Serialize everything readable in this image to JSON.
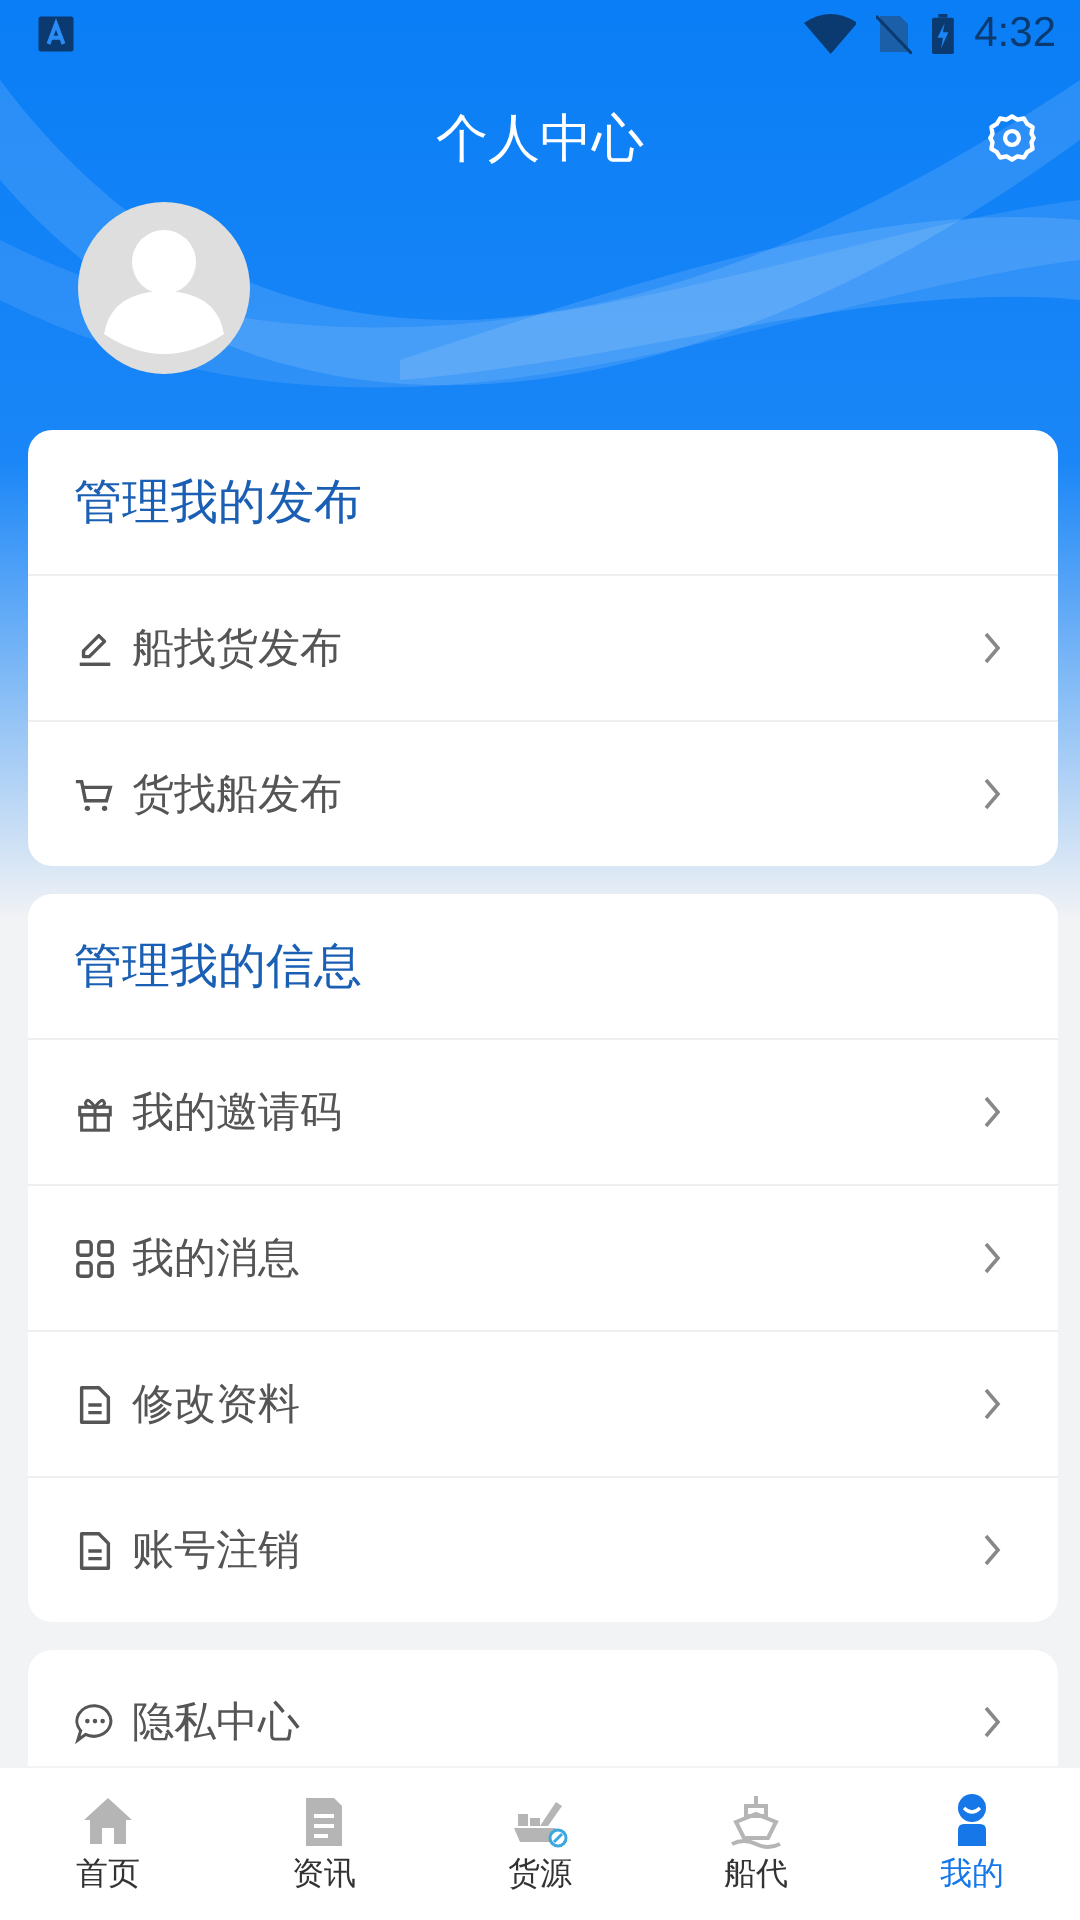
{
  "status_bar": {
    "time": "4:32"
  },
  "header": {
    "title": "个人中心"
  },
  "sections": [
    {
      "title": "管理我的发布",
      "items": [
        {
          "label": "船找货发布",
          "kind": "pencil"
        },
        {
          "label": "货找船发布",
          "kind": "cart"
        }
      ]
    },
    {
      "title": "管理我的信息",
      "items": [
        {
          "label": "我的邀请码",
          "kind": "gift"
        },
        {
          "label": "我的消息",
          "kind": "grid"
        },
        {
          "label": "修改资料",
          "kind": "doc"
        },
        {
          "label": "账号注销",
          "kind": "doc"
        }
      ]
    },
    {
      "items": [
        {
          "label": "隐私中心",
          "kind": "chat"
        }
      ]
    }
  ],
  "bottom_nav": [
    {
      "label": "首页",
      "kind": "home",
      "selected": false
    },
    {
      "label": "资讯",
      "kind": "news",
      "selected": false
    },
    {
      "label": "货源",
      "kind": "cargo",
      "selected": false
    },
    {
      "label": "船代",
      "kind": "ship",
      "selected": false
    },
    {
      "label": "我的",
      "kind": "person",
      "selected": true
    }
  ]
}
